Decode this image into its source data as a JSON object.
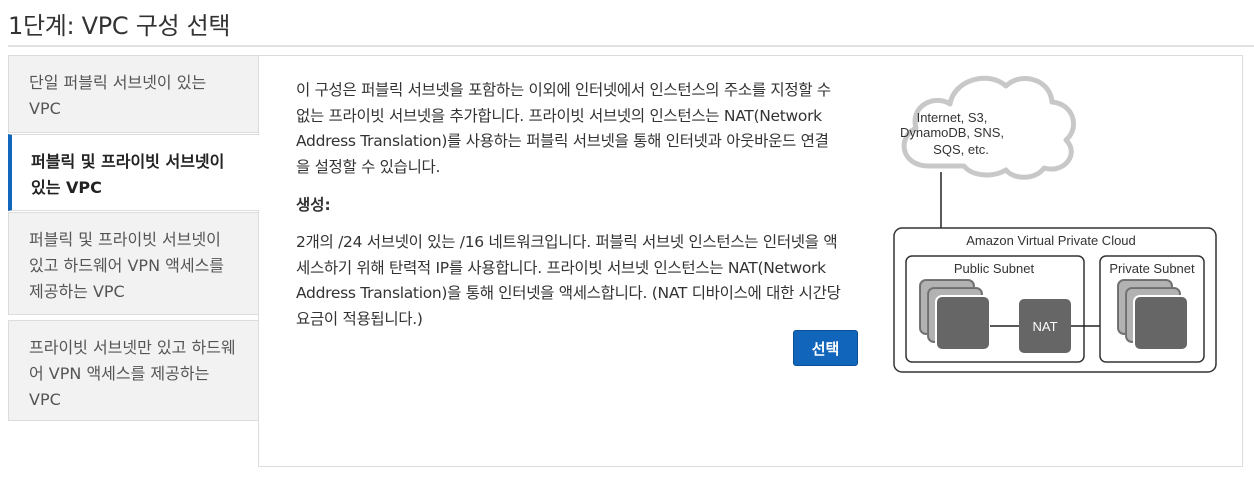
{
  "page": {
    "title": "1단계: VPC 구성 선택"
  },
  "sidebar": {
    "items": [
      {
        "label": "단일 퍼블릭 서브넷이 있는 VPC",
        "lines": [
          "단일 퍼블릭 서브넷이 있는",
          "VPC"
        ]
      },
      {
        "label": "퍼블릭 및 프라이빗 서브넷이 있는 VPC",
        "lines": [
          "퍼블릭 및 프라이빗 서브넷이",
          "있는 VPC"
        ],
        "selected": true
      },
      {
        "label": "퍼블릭 및 프라이빗 서브넷이 있고 하드웨어 VPN 액세스를 제공하는 VPC",
        "lines": [
          "퍼블릭 및 프라이빗 서브넷이",
          "있고 하드웨어 VPN 액세스를",
          "제공하는 VPC"
        ]
      },
      {
        "label": "프라이빗 서브넷만 있고 하드웨어 VPN 액세스를 제공하는 VPC",
        "lines": [
          "프라이빗 서브넷만 있고 하드웨",
          "어 VPN 액세스를 제공하는",
          "VPC"
        ]
      }
    ]
  },
  "main": {
    "description_lines": [
      "이 구성은 퍼블릭 서브넷을 포함하는 이외에 인터넷에서 인스턴스의 주소를 지정할 수",
      "없는 프라이빗 서브넷을 추가합니다. 프라이빗 서브넷의 인스턴스는 NAT(Network",
      "Address Translation)를 사용하는 퍼블릭 서브넷을 통해 인터넷과 아웃바운드 연결",
      "을 설정할 수 있습니다."
    ],
    "create_heading": "생성:",
    "create_lines": [
      "2개의 /24 서브넷이 있는 /16 네트워크입니다. 퍼블릭 서브넷 인스턴스는 인터넷을 액",
      "세스하기 위해 탄력적 IP를 사용합니다. 프라이빗 서브넷 인스턴스는 NAT(Network",
      "Address Translation)을 통해 인터넷을 액세스합니다. (NAT 디바이스에 대한 시간당",
      "요금이 적용됩니다.)"
    ],
    "select_button": "선택"
  },
  "diagram": {
    "cloud_lines": [
      "Internet, S3,",
      "DynamoDB, SNS,",
      "SQS, etc."
    ],
    "vpc_label": "Amazon Virtual Private Cloud",
    "public_subnet_label": "Public Subnet",
    "private_subnet_label": "Private Subnet",
    "nat_label": "NAT"
  },
  "colors": {
    "accent": "#1166bb",
    "instance": "#666666",
    "cloud": "#c8c8c8"
  }
}
